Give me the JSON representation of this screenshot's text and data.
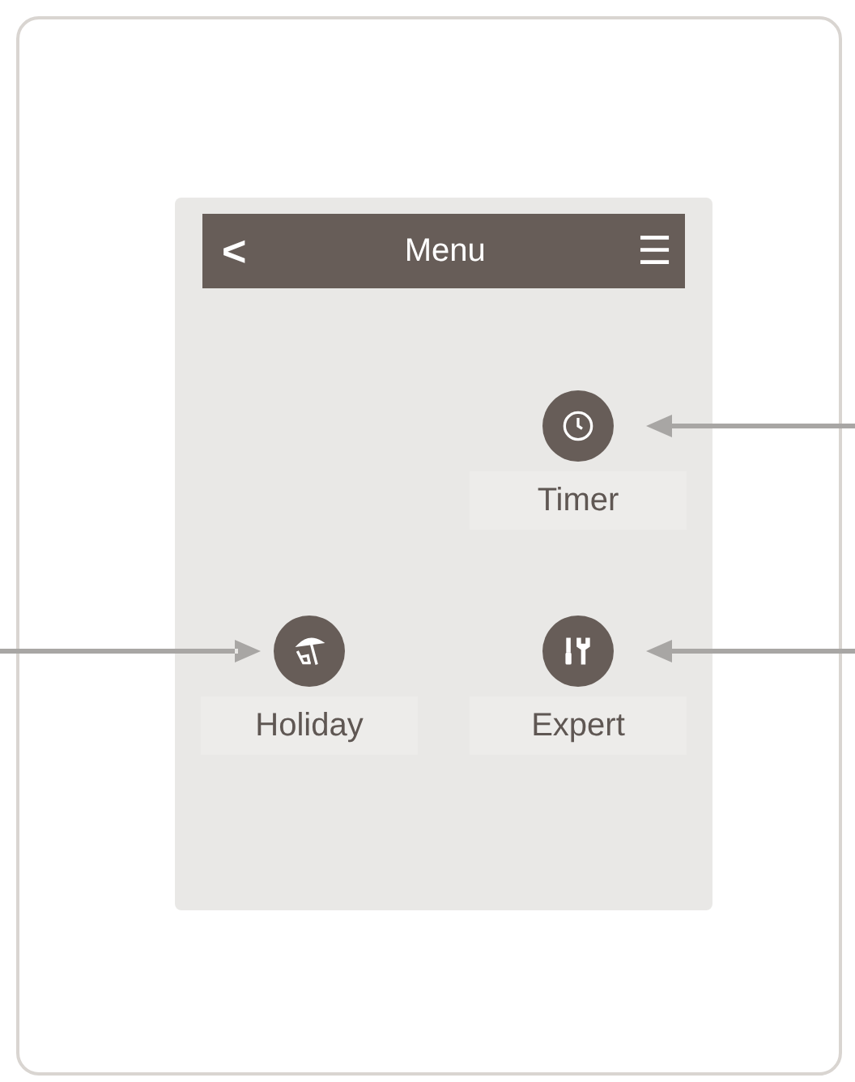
{
  "header": {
    "back": "<",
    "title": "Menu",
    "menu": "☰"
  },
  "rows": [
    {
      "items": [
        {
          "kind": "empty"
        },
        {
          "kind": "clock",
          "label": "Timer"
        }
      ]
    },
    {
      "items": [
        {
          "kind": "beach",
          "label": "Holiday"
        },
        {
          "kind": "tools",
          "label": "Expert"
        }
      ]
    }
  ]
}
